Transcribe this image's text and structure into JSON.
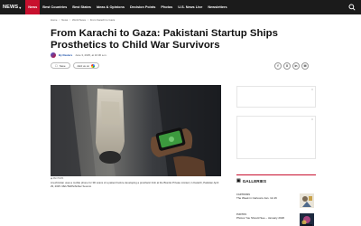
{
  "nav": {
    "brand": "NEWS",
    "items": [
      "News",
      "Best Countries",
      "Best States",
      "Ideas & Opinions",
      "Decision Points",
      "Photos",
      "U.S. News Live",
      "Newsletters"
    ],
    "active_index": 0
  },
  "breadcrumb": [
    "Home",
    "News",
    "World News",
    "From Karachi to Gaza"
  ],
  "article": {
    "headline": "From Karachi to Gaza: Pakistani Startup Ships Prosthetics to Child War Survivors",
    "author": "By Reuters",
    "date": "June 3, 2025, at 10:30 a.m.",
    "save_label": "Save",
    "google_label": "Add us on",
    "share": [
      "f",
      "X",
      "in",
      "✉"
    ],
    "photo_credit": "REUTERS",
    "caption": "A technician uses a mobile phone for 3D scans of a patient before developing a prosthetic limb at the Bionikx Private Limited, in Karachi, Pakistan April 29, 2025. REUTERS/Akhtar Soomro"
  },
  "sidebar": {
    "galleries_title": "GALLERIES",
    "items": [
      {
        "kicker": "CARTOONS",
        "title": "The Week in Cartoons Jan. 12-16"
      },
      {
        "kicker": "PHOTOS",
        "title": "Photos You Should See – January 2026"
      }
    ]
  },
  "colors": {
    "nav_bg": "#1b1b1b",
    "accent": "#c8102e",
    "link": "#1a4fa8"
  }
}
